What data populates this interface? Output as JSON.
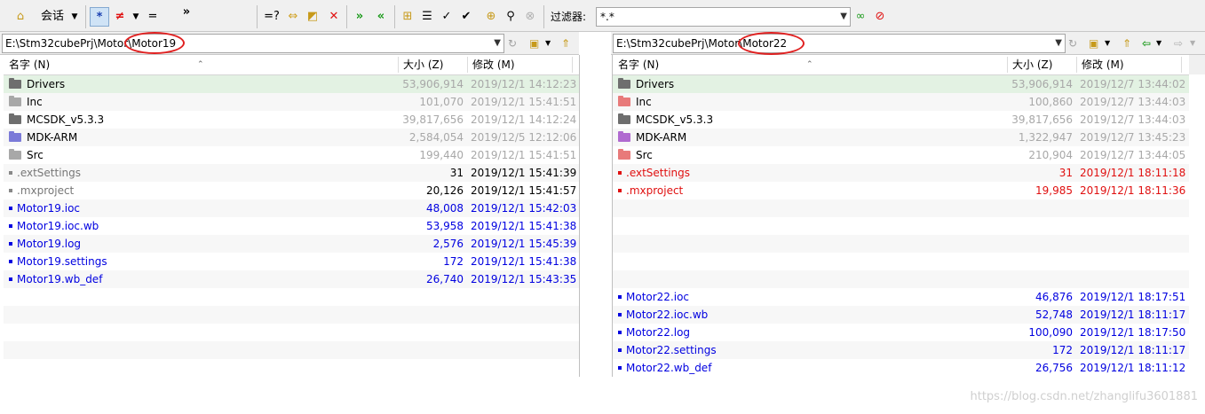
{
  "toolbar": {
    "session_label": "会话",
    "all_symbol": "*",
    "diff_symbol": "≠",
    "same_symbol": "=",
    "more_symbol": "»",
    "compare_symbol": "=?",
    "filter_label": "过滤器:",
    "filter_value": "*.*"
  },
  "left": {
    "path_prefix": "E:\\Stm32cubePrj\\Motor\\",
    "path_folder": "Motor19",
    "headers": {
      "name": "名字 (N)",
      "size": "大小 (Z)",
      "modified": "修改 (M)"
    },
    "rows": [
      {
        "type": "folder",
        "name": "Drivers",
        "size": "53,906,914",
        "date": "2019/12/1 14:12:23",
        "name_color": "black",
        "meta_color": "gray",
        "icon": "#6e6e6e",
        "sel": true
      },
      {
        "type": "folder",
        "name": "Inc",
        "size": "101,070",
        "date": "2019/12/1 15:41:51",
        "name_color": "black",
        "meta_color": "gray",
        "icon": "#a8a8a8"
      },
      {
        "type": "folder",
        "name": "MCSDK_v5.3.3",
        "size": "39,817,656",
        "date": "2019/12/1 14:12:24",
        "name_color": "black",
        "meta_color": "gray",
        "icon": "#6e6e6e"
      },
      {
        "type": "folder",
        "name": "MDK-ARM",
        "size": "2,584,054",
        "date": "2019/12/5 12:12:06",
        "name_color": "black",
        "meta_color": "gray",
        "icon": "#7b7ad8"
      },
      {
        "type": "folder",
        "name": "Src",
        "size": "199,440",
        "date": "2019/12/1 15:41:51",
        "name_color": "black",
        "meta_color": "gray",
        "icon": "#a8a8a8"
      },
      {
        "type": "file",
        "name": ".extSettings",
        "size": "31",
        "date": "2019/12/1 15:41:39",
        "name_color": "dgray",
        "meta_color": "black",
        "icon": "#888888"
      },
      {
        "type": "file",
        "name": ".mxproject",
        "size": "20,126",
        "date": "2019/12/1 15:41:57",
        "name_color": "dgray",
        "meta_color": "black",
        "icon": "#888888"
      },
      {
        "type": "file",
        "name": "Motor19.ioc",
        "size": "48,008",
        "date": "2019/12/1 15:42:03",
        "name_color": "blue",
        "meta_color": "blue",
        "icon": "#0000e0"
      },
      {
        "type": "file",
        "name": "Motor19.ioc.wb",
        "size": "53,958",
        "date": "2019/12/1 15:41:38",
        "name_color": "blue",
        "meta_color": "blue",
        "icon": "#0000e0"
      },
      {
        "type": "file",
        "name": "Motor19.log",
        "size": "2,576",
        "date": "2019/12/1 15:45:39",
        "name_color": "blue",
        "meta_color": "blue",
        "icon": "#0000e0"
      },
      {
        "type": "file",
        "name": "Motor19.settings",
        "size": "172",
        "date": "2019/12/1 15:41:38",
        "name_color": "blue",
        "meta_color": "blue",
        "icon": "#0000e0"
      },
      {
        "type": "file",
        "name": "Motor19.wb_def",
        "size": "26,740",
        "date": "2019/12/1 15:43:35",
        "name_color": "blue",
        "meta_color": "blue",
        "icon": "#0000e0"
      },
      {
        "type": "empty"
      },
      {
        "type": "empty"
      },
      {
        "type": "empty"
      },
      {
        "type": "empty"
      },
      {
        "type": "empty"
      }
    ]
  },
  "right": {
    "path_prefix": "E:\\Stm32cubePrj\\Motor\\",
    "path_folder": "Motor22",
    "headers": {
      "name": "名字 (N)",
      "size": "大小 (Z)",
      "modified": "修改 (M)"
    },
    "rows": [
      {
        "type": "folder",
        "name": "Drivers",
        "size": "53,906,914",
        "date": "2019/12/7 13:44:02",
        "name_color": "black",
        "meta_color": "gray",
        "icon": "#6e6e6e",
        "sel": true
      },
      {
        "type": "folder",
        "name": "Inc",
        "size": "100,860",
        "date": "2019/12/7 13:44:03",
        "name_color": "black",
        "meta_color": "gray",
        "icon": "#e87a7a"
      },
      {
        "type": "folder",
        "name": "MCSDK_v5.3.3",
        "size": "39,817,656",
        "date": "2019/12/7 13:44:03",
        "name_color": "black",
        "meta_color": "gray",
        "icon": "#6e6e6e"
      },
      {
        "type": "folder",
        "name": "MDK-ARM",
        "size": "1,322,947",
        "date": "2019/12/7 13:45:23",
        "name_color": "black",
        "meta_color": "gray",
        "icon": "#b06ad0"
      },
      {
        "type": "folder",
        "name": "Src",
        "size": "210,904",
        "date": "2019/12/7 13:44:05",
        "name_color": "black",
        "meta_color": "gray",
        "icon": "#e87a7a"
      },
      {
        "type": "file",
        "name": ".extSettings",
        "size": "31",
        "date": "2019/12/1 18:11:18",
        "name_color": "red",
        "meta_color": "red",
        "icon": "#e01010"
      },
      {
        "type": "file",
        "name": ".mxproject",
        "size": "19,985",
        "date": "2019/12/1 18:11:36",
        "name_color": "red",
        "meta_color": "red",
        "icon": "#e01010"
      },
      {
        "type": "empty"
      },
      {
        "type": "empty"
      },
      {
        "type": "empty"
      },
      {
        "type": "empty"
      },
      {
        "type": "empty"
      },
      {
        "type": "file",
        "name": "Motor22.ioc",
        "size": "46,876",
        "date": "2019/12/1 18:17:51",
        "name_color": "blue",
        "meta_color": "blue",
        "icon": "#0000e0"
      },
      {
        "type": "file",
        "name": "Motor22.ioc.wb",
        "size": "52,748",
        "date": "2019/12/1 18:11:17",
        "name_color": "blue",
        "meta_color": "blue",
        "icon": "#0000e0"
      },
      {
        "type": "file",
        "name": "Motor22.log",
        "size": "100,090",
        "date": "2019/12/1 18:17:50",
        "name_color": "blue",
        "meta_color": "blue",
        "icon": "#0000e0"
      },
      {
        "type": "file",
        "name": "Motor22.settings",
        "size": "172",
        "date": "2019/12/1 18:11:17",
        "name_color": "blue",
        "meta_color": "blue",
        "icon": "#0000e0"
      },
      {
        "type": "file",
        "name": "Motor22.wb_def",
        "size": "26,756",
        "date": "2019/12/1 18:11:12",
        "name_color": "blue",
        "meta_color": "blue",
        "icon": "#0000e0"
      }
    ]
  },
  "watermark": "https://blog.csdn.net/zhanglifu3601881"
}
